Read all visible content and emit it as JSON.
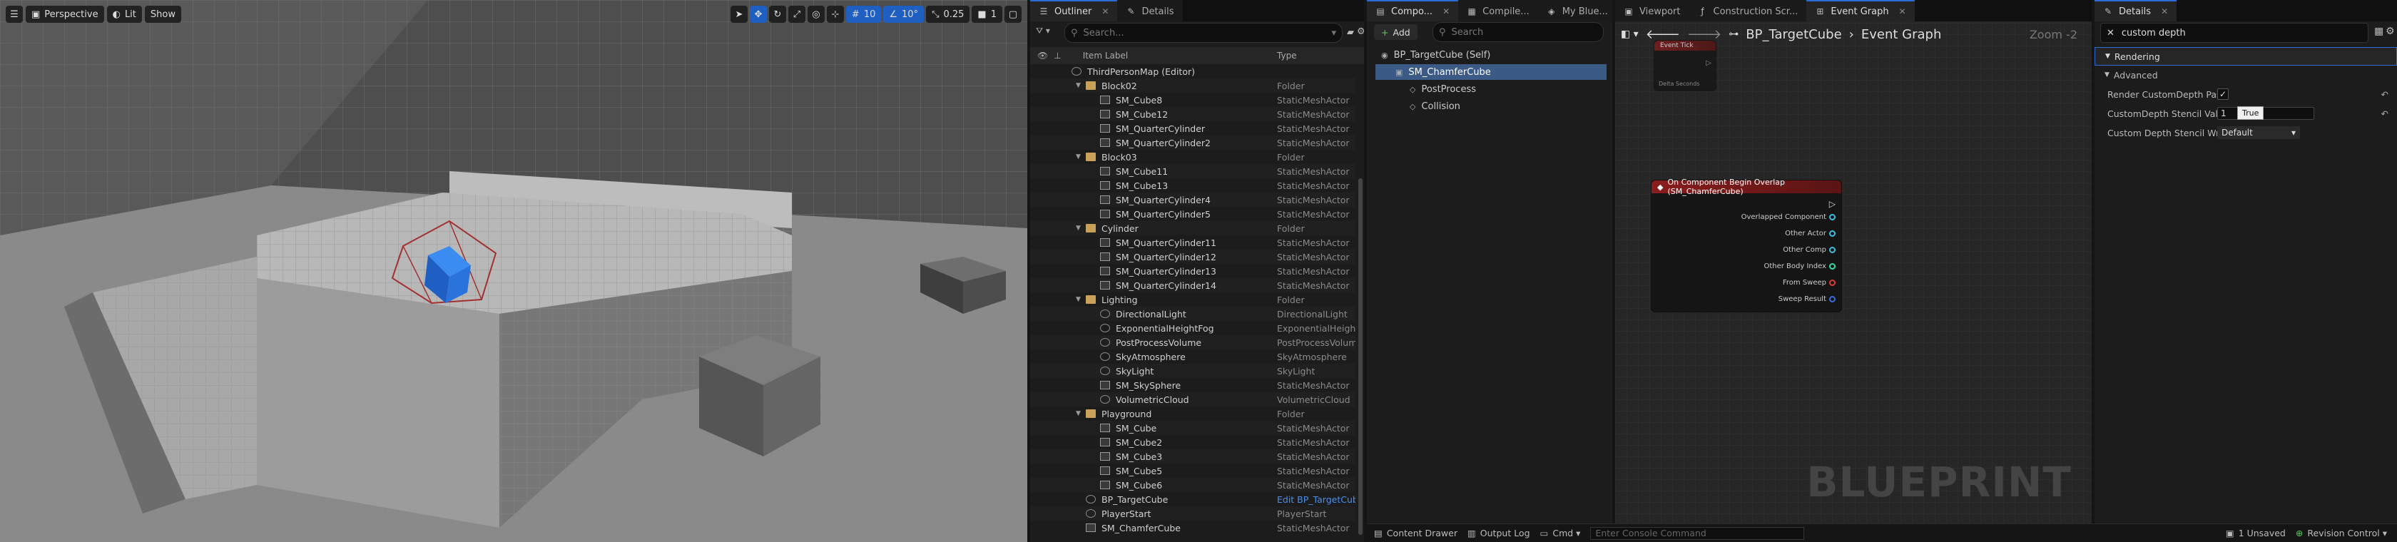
{
  "viewport": {
    "perspective_label": "Perspective",
    "lit_label": "Lit",
    "show_label": "Show",
    "grid_snap": "10",
    "rotation_snap": "10°",
    "scale_snap": "0.25",
    "camera_speed": "1"
  },
  "outliner": {
    "tab_label": "Outliner",
    "details_tab_label": "Details",
    "search_placeholder": "Search...",
    "col_label": "Item Label",
    "col_type": "Type",
    "rows": [
      {
        "label": "ThirdPersonMap (Editor)",
        "type": "",
        "depth": 0,
        "kind": "map"
      },
      {
        "label": "Block02",
        "type": "Folder",
        "depth": 1,
        "kind": "folder"
      },
      {
        "label": "SM_Cube8",
        "type": "StaticMeshActor",
        "depth": 2,
        "kind": "mesh"
      },
      {
        "label": "SM_Cube12",
        "type": "StaticMeshActor",
        "depth": 2,
        "kind": "mesh"
      },
      {
        "label": "SM_QuarterCylinder",
        "type": "StaticMeshActor",
        "depth": 2,
        "kind": "mesh"
      },
      {
        "label": "SM_QuarterCylinder2",
        "type": "StaticMeshActor",
        "depth": 2,
        "kind": "mesh"
      },
      {
        "label": "Block03",
        "type": "Folder",
        "depth": 1,
        "kind": "folder"
      },
      {
        "label": "SM_Cube11",
        "type": "StaticMeshActor",
        "depth": 2,
        "kind": "mesh"
      },
      {
        "label": "SM_Cube13",
        "type": "StaticMeshActor",
        "depth": 2,
        "kind": "mesh"
      },
      {
        "label": "SM_QuarterCylinder4",
        "type": "StaticMeshActor",
        "depth": 2,
        "kind": "mesh"
      },
      {
        "label": "SM_QuarterCylinder5",
        "type": "StaticMeshActor",
        "depth": 2,
        "kind": "mesh"
      },
      {
        "label": "Cylinder",
        "type": "Folder",
        "depth": 1,
        "kind": "folder"
      },
      {
        "label": "SM_QuarterCylinder11",
        "type": "StaticMeshActor",
        "depth": 2,
        "kind": "mesh"
      },
      {
        "label": "SM_QuarterCylinder12",
        "type": "StaticMeshActor",
        "depth": 2,
        "kind": "mesh"
      },
      {
        "label": "SM_QuarterCylinder13",
        "type": "StaticMeshActor",
        "depth": 2,
        "kind": "mesh"
      },
      {
        "label": "SM_QuarterCylinder14",
        "type": "StaticMeshActor",
        "depth": 2,
        "kind": "mesh"
      },
      {
        "label": "Lighting",
        "type": "Folder",
        "depth": 1,
        "kind": "folder"
      },
      {
        "label": "DirectionalLight",
        "type": "DirectionalLight",
        "depth": 2,
        "kind": "light"
      },
      {
        "label": "ExponentialHeightFog",
        "type": "ExponentialHeightF",
        "depth": 2,
        "kind": "light"
      },
      {
        "label": "PostProcessVolume",
        "type": "PostProcessVolum",
        "depth": 2,
        "kind": "light"
      },
      {
        "label": "SkyAtmosphere",
        "type": "SkyAtmosphere",
        "depth": 2,
        "kind": "light"
      },
      {
        "label": "SkyLight",
        "type": "SkyLight",
        "depth": 2,
        "kind": "light"
      },
      {
        "label": "SM_SkySphere",
        "type": "StaticMeshActor",
        "depth": 2,
        "kind": "mesh"
      },
      {
        "label": "VolumetricCloud",
        "type": "VolumetricCloud",
        "depth": 2,
        "kind": "light"
      },
      {
        "label": "Playground",
        "type": "Folder",
        "depth": 1,
        "kind": "folder"
      },
      {
        "label": "SM_Cube",
        "type": "StaticMeshActor",
        "depth": 2,
        "kind": "mesh"
      },
      {
        "label": "SM_Cube2",
        "type": "StaticMeshActor",
        "depth": 2,
        "kind": "mesh"
      },
      {
        "label": "SM_Cube3",
        "type": "StaticMeshActor",
        "depth": 2,
        "kind": "mesh"
      },
      {
        "label": "SM_Cube5",
        "type": "StaticMeshActor",
        "depth": 2,
        "kind": "mesh"
      },
      {
        "label": "SM_Cube6",
        "type": "StaticMeshActor",
        "depth": 2,
        "kind": "mesh"
      },
      {
        "label": "BP_TargetCube",
        "type": "Edit BP_TargetCub",
        "depth": 1,
        "kind": "bp",
        "link": true
      },
      {
        "label": "PlayerStart",
        "type": "PlayerStart",
        "depth": 1,
        "kind": "light"
      },
      {
        "label": "SM_ChamferCube",
        "type": "StaticMeshActor",
        "depth": 1,
        "kind": "mesh"
      }
    ]
  },
  "components": {
    "tab_label": "Compo...",
    "compile_tab": "Compile...",
    "blueprint_tab": "My Blue...",
    "add_label": "Add",
    "search_placeholder": "Search",
    "items": [
      {
        "label": "BP_TargetCube (Self)",
        "depth": 0,
        "selected": false
      },
      {
        "label": "SM_ChamferCube",
        "depth": 1,
        "selected": true
      },
      {
        "label": "PostProcess",
        "depth": 2,
        "selected": false
      },
      {
        "label": "Collision",
        "depth": 2,
        "selected": false
      }
    ]
  },
  "graph": {
    "tabs": [
      "Viewport",
      "Construction Scr...",
      "Event Graph"
    ],
    "breadcrumb_bp": "BP_TargetCube",
    "breadcrumb_graph": "Event Graph",
    "zoom": "Zoom -2",
    "node_small_title": "Event Tick",
    "node_small_pin": "Delta Seconds",
    "node_title": "On Component Begin Overlap (SM_ChamferCube)",
    "node_pins": [
      "Overlapped Component",
      "Other Actor",
      "Other Comp",
      "Other Body Index",
      "From Sweep",
      "Sweep Result"
    ],
    "watermark": "BLUEPRINT"
  },
  "details": {
    "tab_label": "Details",
    "search_value": "custom depth",
    "section": "Rendering",
    "subsection": "Advanced",
    "props": [
      {
        "label": "Render CustomDepth Pass",
        "value": "checked"
      },
      {
        "label": "CustomDepth Stencil Value",
        "value": "1"
      },
      {
        "label": "Custom Depth Stencil Writ...",
        "value": "Default"
      }
    ],
    "tooltip": "True"
  },
  "bottom": {
    "content_drawer": "Content Drawer",
    "output_log": "Output Log",
    "cmd": "Cmd",
    "console_placeholder": "Enter Console Command",
    "unsaved": "1 Unsaved",
    "revision": "Revision Control"
  }
}
